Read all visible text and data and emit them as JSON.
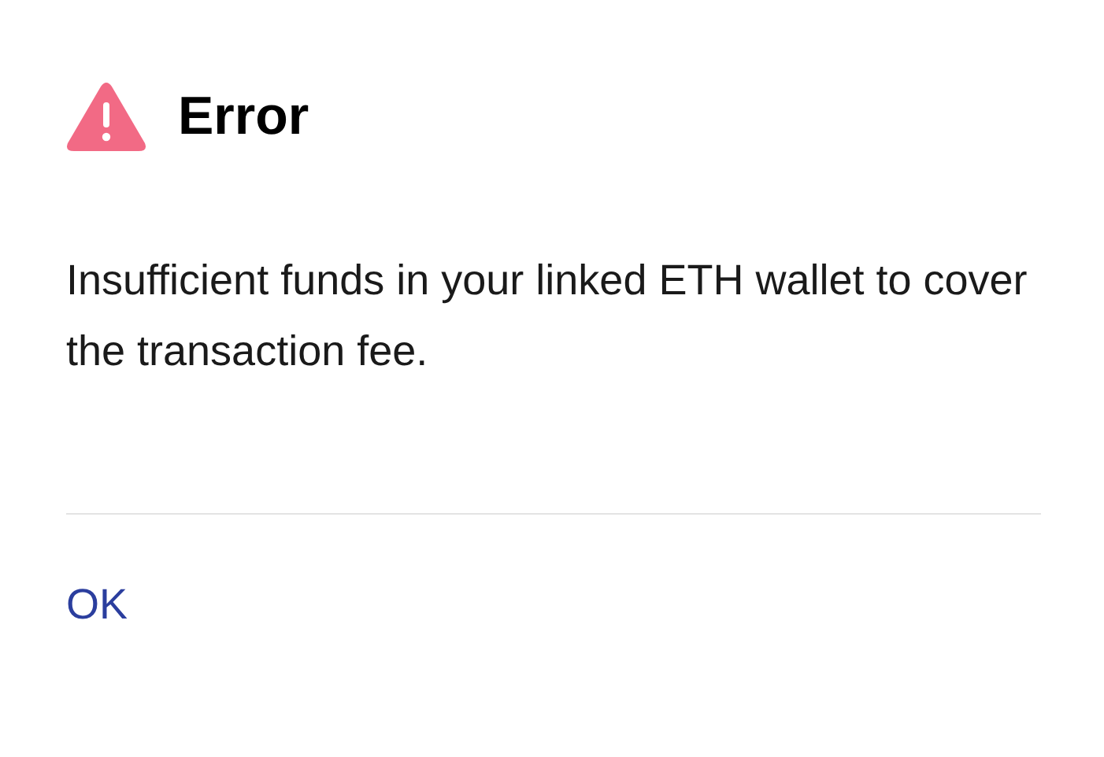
{
  "dialog": {
    "title": "Error",
    "message": "Insufficient funds in your linked ETH wallet to cover the transaction fee.",
    "buttons": [
      "OK"
    ]
  }
}
